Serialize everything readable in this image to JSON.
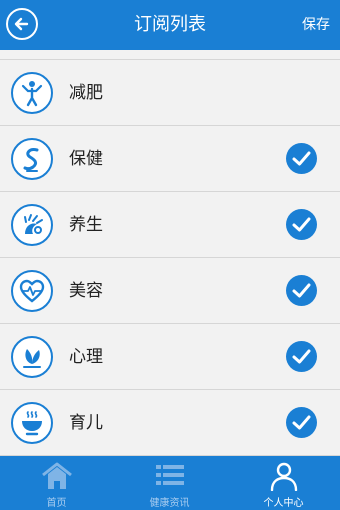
{
  "header": {
    "title": "订阅列表",
    "save_label": "保存"
  },
  "subscriptions": [
    {
      "label": "减肥",
      "icon": "yoga-person-icon",
      "checked": false
    },
    {
      "label": "保健",
      "icon": "swirl-s-icon",
      "checked": true
    },
    {
      "label": "养生",
      "icon": "peacock-icon",
      "checked": true
    },
    {
      "label": "美容",
      "icon": "heart-pulse-icon",
      "checked": true
    },
    {
      "label": "心理",
      "icon": "leaf-icon",
      "checked": true
    },
    {
      "label": "育儿",
      "icon": "bowl-icon",
      "checked": true
    }
  ],
  "tabs": [
    {
      "label": "首页",
      "icon": "home-icon",
      "active": false
    },
    {
      "label": "健康资讯",
      "icon": "list-icon",
      "active": false
    },
    {
      "label": "个人中心",
      "icon": "person-icon",
      "active": true
    }
  ],
  "colors": {
    "primary": "#1a7fd4",
    "background": "#f2f2f2",
    "inactive_tab_text": "#a9cdf0"
  }
}
